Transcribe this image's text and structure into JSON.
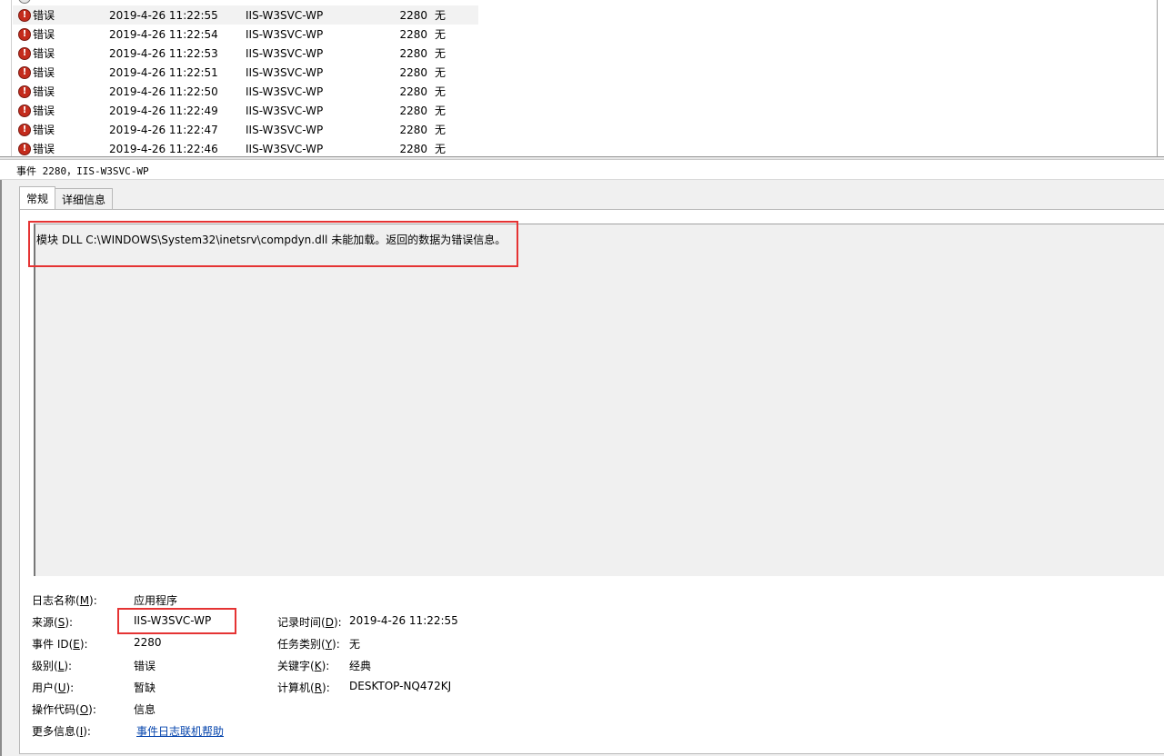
{
  "event_list": {
    "rows": [
      {
        "level": "错误",
        "datetime": "2019-4-26 11:22:55",
        "source": "IIS-W3SVC-WP",
        "event_id": "2280",
        "task": "无"
      },
      {
        "level": "错误",
        "datetime": "2019-4-26 11:22:54",
        "source": "IIS-W3SVC-WP",
        "event_id": "2280",
        "task": "无"
      },
      {
        "level": "错误",
        "datetime": "2019-4-26 11:22:53",
        "source": "IIS-W3SVC-WP",
        "event_id": "2280",
        "task": "无"
      },
      {
        "level": "错误",
        "datetime": "2019-4-26 11:22:51",
        "source": "IIS-W3SVC-WP",
        "event_id": "2280",
        "task": "无"
      },
      {
        "level": "错误",
        "datetime": "2019-4-26 11:22:50",
        "source": "IIS-W3SVC-WP",
        "event_id": "2280",
        "task": "无"
      },
      {
        "level": "错误",
        "datetime": "2019-4-26 11:22:49",
        "source": "IIS-W3SVC-WP",
        "event_id": "2280",
        "task": "无"
      },
      {
        "level": "错误",
        "datetime": "2019-4-26 11:22:47",
        "source": "IIS-W3SVC-WP",
        "event_id": "2280",
        "task": "无"
      },
      {
        "level": "错误",
        "datetime": "2019-4-26 11:22:46",
        "source": "IIS-W3SVC-WP",
        "event_id": "2280",
        "task": "无"
      }
    ],
    "error_glyph": "!"
  },
  "detail": {
    "header": "事件 2280，IIS-W3SVC-WP",
    "tabs": [
      "常规",
      "详细信息"
    ],
    "message": "模块 DLL C:\\WINDOWS\\System32\\inetsrv\\compdyn.dll 未能加载。返回的数据为错误信息。",
    "props": {
      "log_name_label": "日志名称(",
      "log_name_key": "M",
      "log_name_value": "应用程序",
      "source_label": "来源(",
      "source_key": "S",
      "source_value": "IIS-W3SVC-WP",
      "logged_label": "记录时间(",
      "logged_key": "D",
      "logged_value": "2019-4-26 11:22:55",
      "event_id_label": "事件 ID(",
      "event_id_key": "E",
      "event_id_value": "2280",
      "task_label": "任务类别(",
      "task_key": "Y",
      "task_value": "无",
      "level_label": "级别(",
      "level_key": "L",
      "level_value": "错误",
      "keywords_label": "关键字(",
      "keywords_key": "K",
      "keywords_value": "经典",
      "user_label": "用户(",
      "user_key": "U",
      "user_value": "暂缺",
      "computer_label": "计算机(",
      "computer_key": "R",
      "computer_value": "DESKTOP-NQ472KJ",
      "opcode_label": "操作代码(",
      "opcode_key": "O",
      "opcode_value": "信息",
      "more_info_label": "更多信息(",
      "more_info_key": "I",
      "more_info_link": "事件日志联机帮助",
      "label_close": "):"
    }
  },
  "colors": {
    "highlight_box": "#e53333",
    "error_icon": "#c42b1c",
    "link": "#0645ad"
  }
}
